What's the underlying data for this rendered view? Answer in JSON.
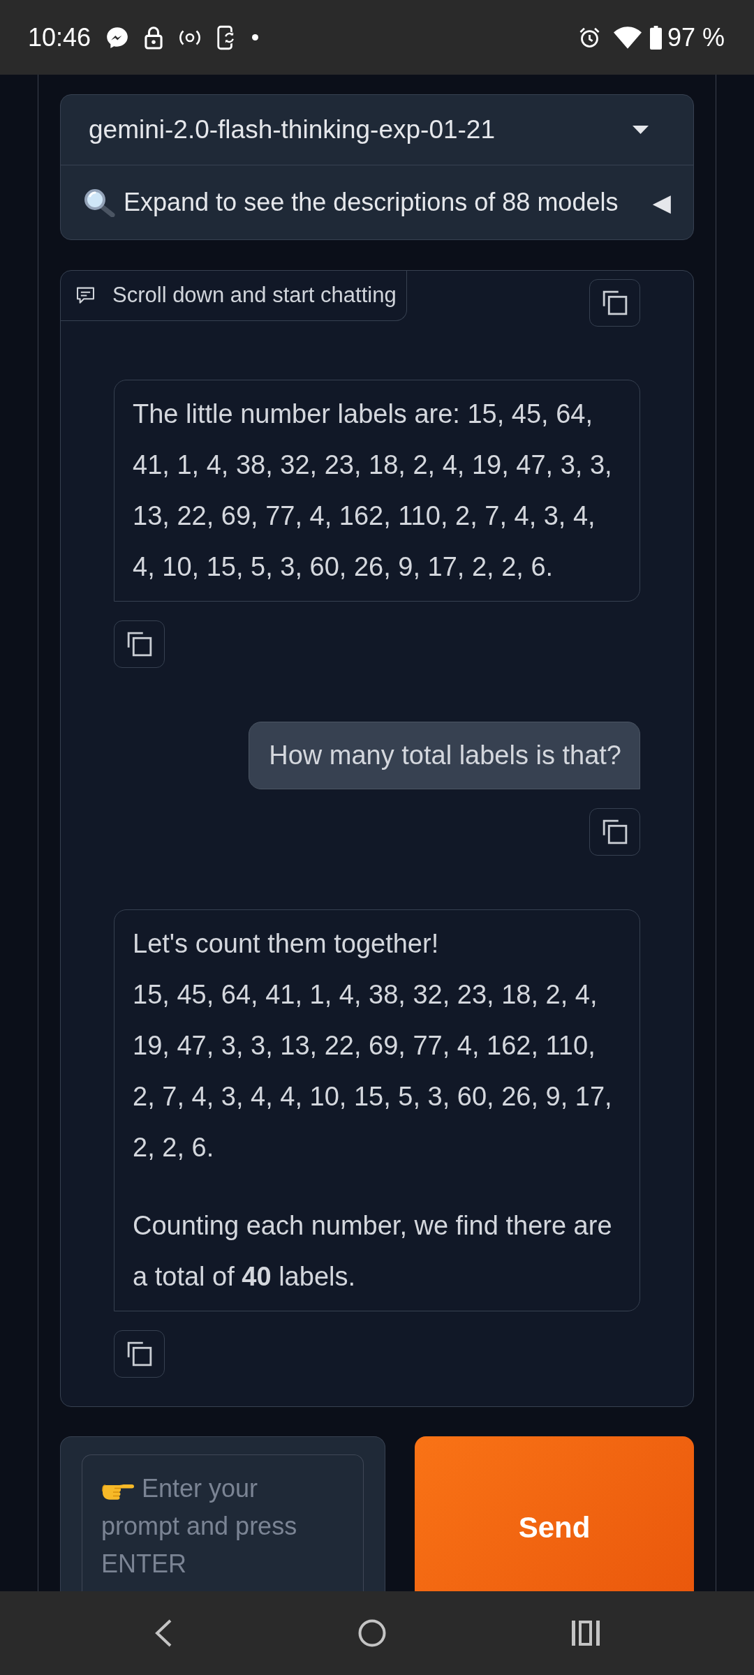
{
  "status_bar": {
    "time": "10:46",
    "battery": "97 %"
  },
  "model_selector": {
    "value": "gemini-2.0-flash-thinking-exp-01-21",
    "accordion": {
      "label": "Expand to see the descriptions of 88 models",
      "indicator": "◀",
      "expanded": false
    }
  },
  "chatbot": {
    "label": "Scroll down and start chatting",
    "messages": [
      {
        "kind": "bot",
        "paragraphs": [
          "The little number labels are: 15, 45, 64, 41, 1, 4, 38, 32, 23, 18, 2, 4, 19, 47, 3, 3, 13, 22, 69, 77, 4, 162, 110, 2, 7, 4, 3, 4, 4, 10, 15, 5, 3, 60, 26, 9, 17, 2, 2, 6."
        ]
      },
      {
        "kind": "user",
        "paragraphs": [
          "How many total labels is that?"
        ]
      },
      {
        "kind": "bot",
        "paragraphs": [
          "Let's count them together!\n15, 45, 64, 41, 1, 4, 38, 32, 23, 18, 2, 4, 19, 47, 3, 3, 13, 22, 69, 77, 4, 162, 110, 2, 7, 4, 3, 4, 4, 10, 15, 5, 3, 60, 26, 9, 17, 2, 2, 6.",
          "Counting each number, we find there are a total of **40** labels."
        ]
      }
    ]
  },
  "prompt": {
    "placeholder": "Enter your prompt and press ENTER"
  },
  "send_button": {
    "label": "Send"
  }
}
